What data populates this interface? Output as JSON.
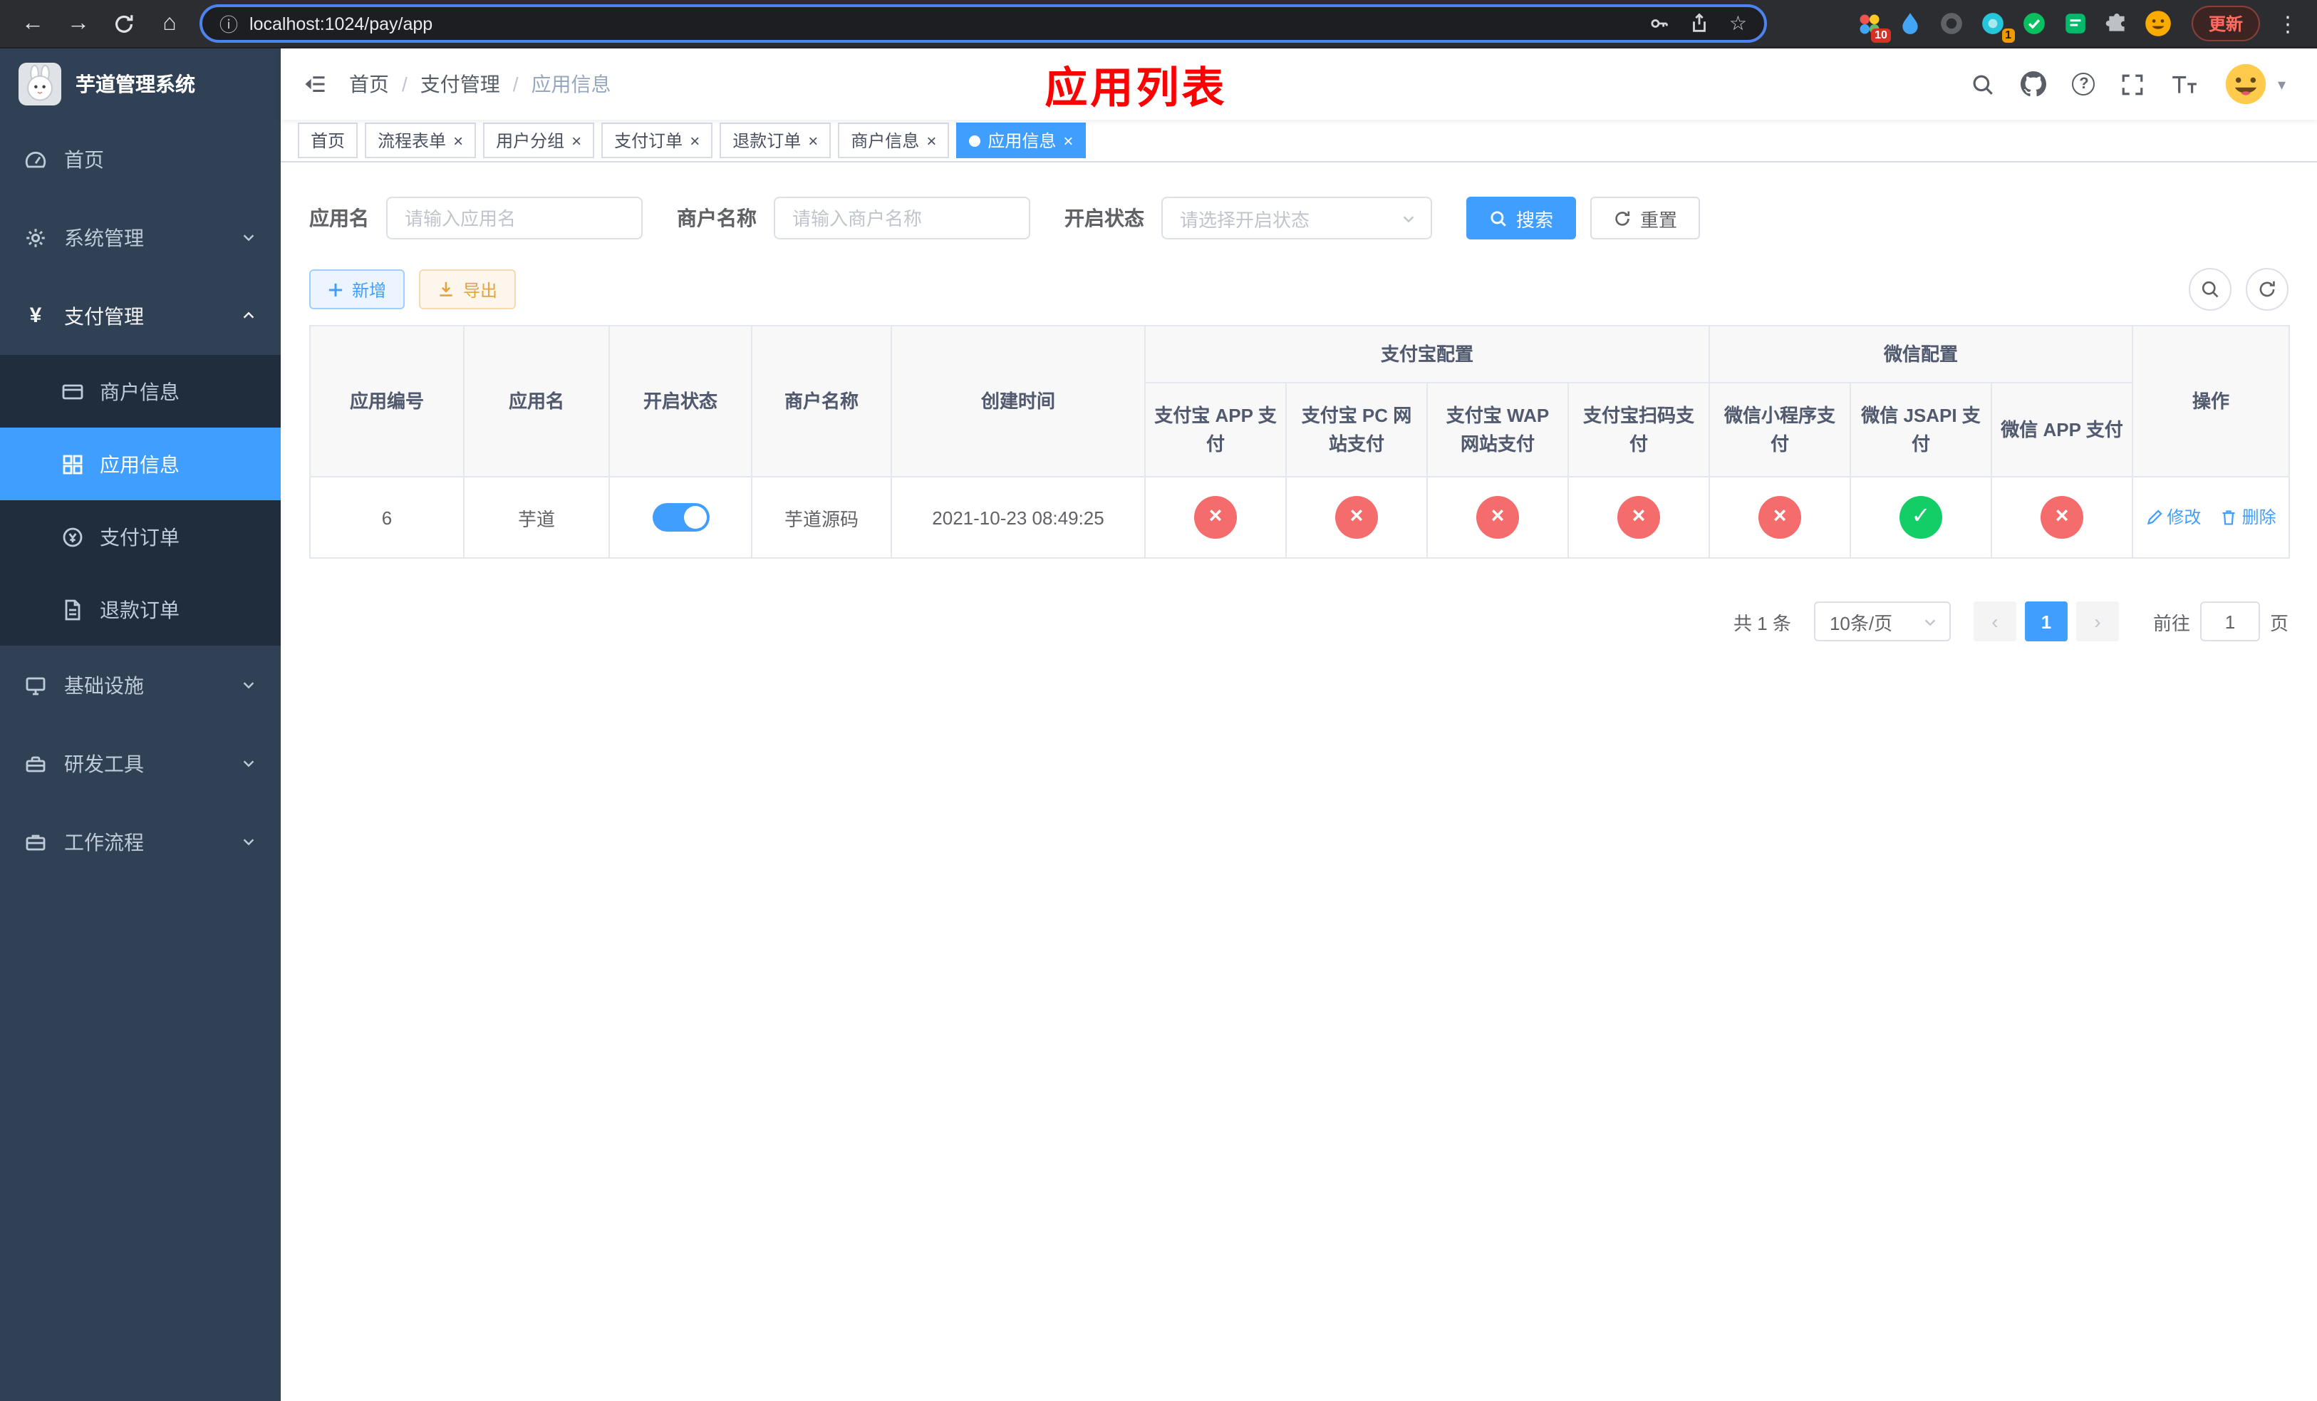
{
  "colors": {
    "accent": "#409EFF",
    "success": "#13ce66",
    "danger": "#f56c6c",
    "warning": "#e6a23c",
    "sidebar_bg": "#304156",
    "sidebar_sub_bg": "#1f2d3d",
    "annotation_red": "#ff0000"
  },
  "icons": {
    "back": "←",
    "forward": "→",
    "home": "⌂",
    "info": "ⓘ",
    "star": "☆",
    "menu_dots": "⋮",
    "close": "×",
    "question": "?",
    "caret_down": "▾",
    "yen": "¥",
    "enabled_mark": "✓",
    "disabled_mark": "×",
    "prev": "‹",
    "next": "›"
  },
  "browser": {
    "url": "localhost:1024/pay/app",
    "update_label": "更新",
    "extension_badge_count": "10",
    "extension_badge_one": "1"
  },
  "sidebar": {
    "title": "芋道管理系统",
    "menu": [
      {
        "label": "首页"
      },
      {
        "label": "系统管理"
      },
      {
        "label": "支付管理"
      },
      {
        "label": "商户信息"
      },
      {
        "label": "应用信息"
      },
      {
        "label": "支付订单"
      },
      {
        "label": "退款订单"
      },
      {
        "label": "基础设施"
      },
      {
        "label": "研发工具"
      },
      {
        "label": "工作流程"
      }
    ]
  },
  "navbar": {
    "breadcrumb": {
      "home": "首页",
      "section": "支付管理",
      "current": "应用信息",
      "separator": "/"
    },
    "annotation": "应用列表"
  },
  "tabs": [
    {
      "label": "首页"
    },
    {
      "label": "流程表单"
    },
    {
      "label": "用户分组"
    },
    {
      "label": "支付订单"
    },
    {
      "label": "退款订单"
    },
    {
      "label": "商户信息"
    },
    {
      "label": "应用信息"
    }
  ],
  "filters": {
    "app_name": {
      "label": "应用名",
      "placeholder": "请输入应用名"
    },
    "merchant_name": {
      "label": "商户名称",
      "placeholder": "请输入商户名称"
    },
    "status": {
      "label": "开启状态",
      "placeholder": "请选择开启状态"
    },
    "search_button": "搜索",
    "reset_button": "重置"
  },
  "toolbar": {
    "add_button": "新增",
    "export_button": "导出"
  },
  "table": {
    "columns": {
      "app_id": "应用编号",
      "app_name": "应用名",
      "status": "开启状态",
      "merchant_name": "商户名称",
      "created_at": "创建时间",
      "alipay_group": "支付宝配置",
      "wechat_group": "微信配置",
      "alipay_app": "支付宝 APP 支付",
      "alipay_pc": "支付宝 PC 网站支付",
      "alipay_wap": "支付宝 WAP 网站支付",
      "alipay_scan": "支付宝扫码支付",
      "wechat_mini": "微信小程序支付",
      "wechat_jsapi": "微信 JSAPI 支付",
      "wechat_app": "微信 APP 支付",
      "actions": "操作"
    },
    "rows": [
      {
        "app_id": "6",
        "app_name": "芋道",
        "enabled": true,
        "merchant_name": "芋道源码",
        "created_at": "2021-10-23 08:49:25",
        "alipay_app": false,
        "alipay_pc": false,
        "alipay_wap": false,
        "alipay_scan": false,
        "wechat_mini": false,
        "wechat_jsapi": true,
        "wechat_app": false,
        "edit_label": "修改",
        "delete_label": "删除"
      }
    ]
  },
  "pagination": {
    "total_text": "共 1 条",
    "page_size": "10条/页",
    "current_page": "1",
    "goto_label": "前往",
    "goto_value": "1",
    "goto_unit": "页"
  }
}
